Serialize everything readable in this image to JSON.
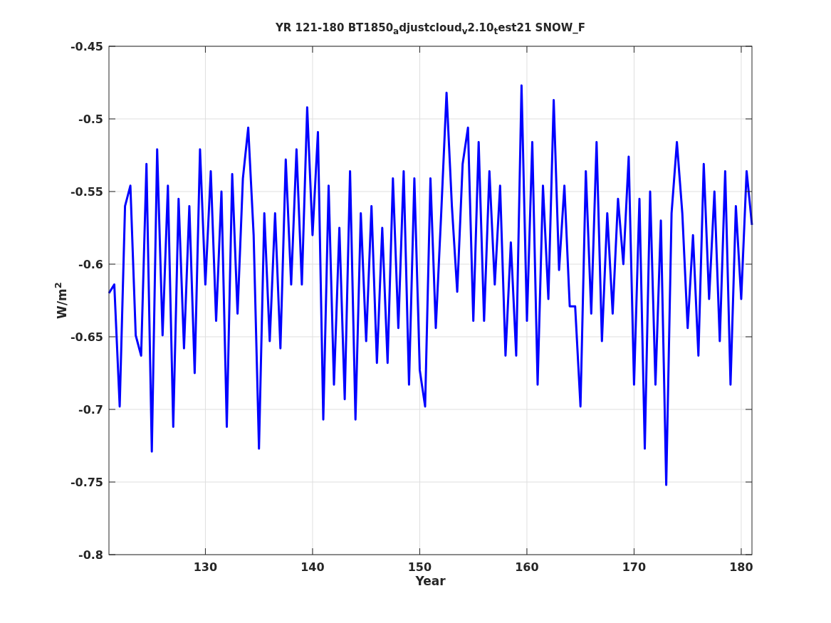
{
  "chart_data": {
    "type": "line",
    "title": "YR 121-180 BT1850$_{a}$djustcloud$_{v}$2.10$_{t}$est21 SNOW_F",
    "xlabel": "Year",
    "ylabel": "W/m$^{2}$",
    "grid": true,
    "xlim": [
      121,
      181
    ],
    "ylim": [
      -0.8,
      -0.45
    ],
    "xticks": [
      130,
      140,
      150,
      160,
      170,
      180
    ],
    "yticks": [
      -0.8,
      -0.75,
      -0.7,
      -0.65,
      -0.6,
      -0.55,
      -0.5,
      -0.45
    ],
    "x": [
      121,
      121.5,
      122,
      122.5,
      123,
      123.5,
      124,
      124.5,
      125,
      125.5,
      126,
      126.5,
      127,
      127.5,
      128,
      128.5,
      129,
      129.5,
      130,
      130.5,
      131,
      131.5,
      132,
      132.5,
      133,
      133.5,
      134,
      134.5,
      135,
      135.5,
      136,
      136.5,
      137,
      137.5,
      138,
      138.5,
      139,
      139.5,
      140,
      140.5,
      141,
      141.5,
      142,
      142.5,
      143,
      143.5,
      144,
      144.5,
      145,
      145.5,
      146,
      146.5,
      147,
      147.5,
      148,
      148.5,
      149,
      149.5,
      150,
      150.5,
      151,
      151.5,
      152,
      152.5,
      153,
      153.5,
      154,
      154.5,
      155,
      155.5,
      156,
      156.5,
      157,
      157.5,
      158,
      158.5,
      159,
      159.5,
      160,
      160.5,
      161,
      161.5,
      162,
      162.5,
      163,
      163.5,
      164,
      164.5,
      165,
      165.5,
      166,
      166.5,
      167,
      167.5,
      168,
      168.5,
      169,
      169.5,
      170,
      170.5,
      171,
      171.5,
      172,
      172.5,
      173,
      173.5,
      174,
      174.5,
      175,
      175.5,
      176,
      176.5,
      177,
      177.5,
      178,
      178.5,
      179,
      179.5,
      180,
      180.5,
      181
    ],
    "series": [
      {
        "color": "#0000ff",
        "values": [
          -0.62,
          -0.614,
          -0.698,
          -0.56,
          -0.546,
          -0.649,
          -0.663,
          -0.531,
          -0.729,
          -0.521,
          -0.649,
          -0.546,
          -0.712,
          -0.555,
          -0.658,
          -0.56,
          -0.675,
          -0.521,
          -0.614,
          -0.536,
          -0.639,
          -0.55,
          -0.712,
          -0.538,
          -0.634,
          -0.541,
          -0.506,
          -0.58,
          -0.727,
          -0.565,
          -0.653,
          -0.565,
          -0.658,
          -0.528,
          -0.614,
          -0.521,
          -0.614,
          -0.492,
          -0.58,
          -0.509,
          -0.707,
          -0.546,
          -0.683,
          -0.575,
          -0.693,
          -0.536,
          -0.707,
          -0.565,
          -0.653,
          -0.56,
          -0.668,
          -0.575,
          -0.668,
          -0.541,
          -0.644,
          -0.536,
          -0.683,
          -0.541,
          -0.673,
          -0.698,
          -0.541,
          -0.644,
          -0.565,
          -0.482,
          -0.56,
          -0.619,
          -0.531,
          -0.506,
          -0.639,
          -0.516,
          -0.639,
          -0.536,
          -0.614,
          -0.546,
          -0.663,
          -0.585,
          -0.663,
          -0.477,
          -0.639,
          -0.516,
          -0.683,
          -0.546,
          -0.624,
          -0.487,
          -0.604,
          -0.546,
          -0.629,
          -0.629,
          -0.698,
          -0.536,
          -0.634,
          -0.516,
          -0.653,
          -0.565,
          -0.634,
          -0.555,
          -0.6,
          -0.526,
          -0.683,
          -0.555,
          -0.727,
          -0.55,
          -0.683,
          -0.57,
          -0.752,
          -0.565,
          -0.516,
          -0.565,
          -0.644,
          -0.58,
          -0.663,
          -0.531,
          -0.624,
          -0.55,
          -0.653,
          -0.536,
          -0.683,
          -0.56,
          -0.624,
          -0.536,
          -0.573
        ]
      }
    ]
  }
}
